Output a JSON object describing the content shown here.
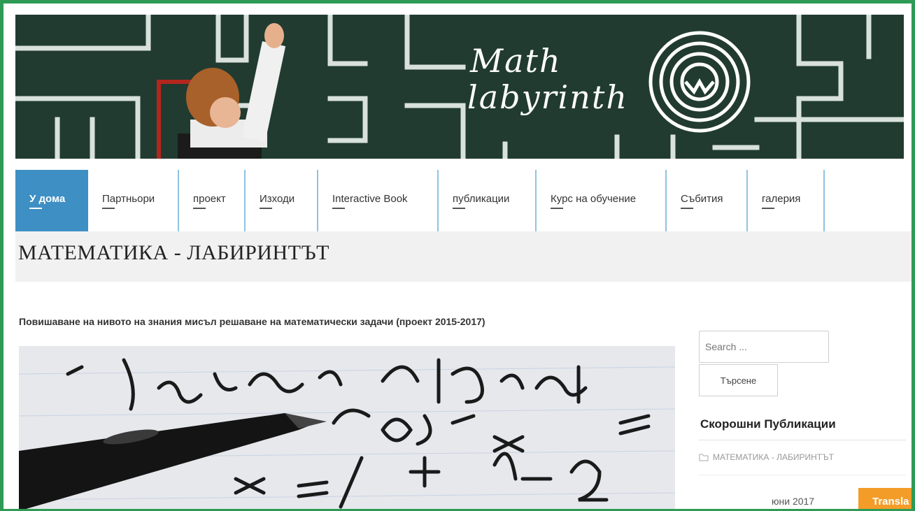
{
  "header": {
    "logo_line1": "Math",
    "logo_line2": "labyrinth"
  },
  "nav": {
    "items": [
      {
        "label": "У дома",
        "active": true
      },
      {
        "label": "Партньори"
      },
      {
        "label": "проект"
      },
      {
        "label": "Изходи"
      },
      {
        "label": "Interactive Book"
      },
      {
        "label": "публикации"
      },
      {
        "label": "Курс на обучение"
      },
      {
        "label": "Събития"
      },
      {
        "label": "галерия"
      }
    ]
  },
  "page": {
    "title": "МАТЕМАТИКА - ЛАБИРИНТЪТ",
    "intro": "Повишаване на нивото на знания мисъл решаване на математически задачи (проект 2015-2017)"
  },
  "sidebar": {
    "search_placeholder": "Search ...",
    "search_button": "Търсене",
    "recent_title": "Скорошни Публикации",
    "recent_items": [
      "МАТЕМАТИКА - ЛАБИРИНТЪТ"
    ],
    "date": "юни 2017"
  },
  "translate_label": "Transla",
  "colors": {
    "frame": "#2e9a55",
    "chalkboard": "#213b30",
    "nav_active": "#3d8fc4",
    "translate": "#f39c28"
  }
}
